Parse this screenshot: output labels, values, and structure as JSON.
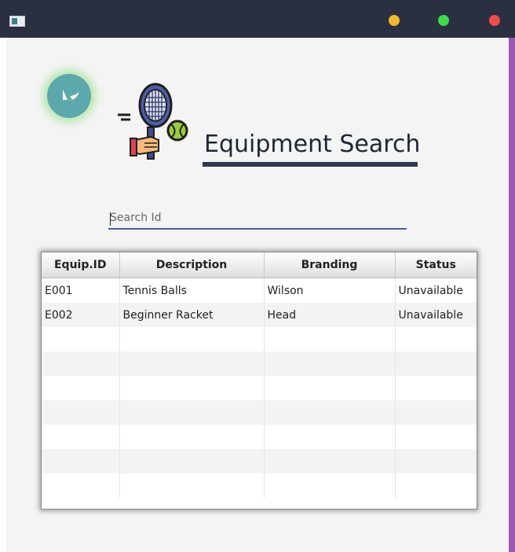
{
  "window": {
    "controls": {
      "minimize": "minimize",
      "maximize": "maximize",
      "close": "close"
    },
    "colors": {
      "minimize": "#f2b92c",
      "maximize": "#3ddc4a",
      "close": "#f14b4b",
      "accent": "#9b59b6"
    }
  },
  "header": {
    "title": "Equipment Search",
    "back_icon": "back-arrow-icon",
    "hero_icon": "tennis-racket-ball-icon"
  },
  "search": {
    "placeholder": "Search Id",
    "value": ""
  },
  "table": {
    "columns": [
      "Equip.ID",
      "Description",
      "Branding",
      "Status"
    ],
    "rows": [
      [
        "E001",
        "Tennis Balls",
        "Wilson",
        "Unavailable"
      ],
      [
        "E002",
        "Beginner Racket",
        "Head",
        "Unavailable"
      ],
      [
        "",
        "",
        "",
        ""
      ],
      [
        "",
        "",
        "",
        ""
      ],
      [
        "",
        "",
        "",
        ""
      ],
      [
        "",
        "",
        "",
        ""
      ],
      [
        "",
        "",
        "",
        ""
      ],
      [
        "",
        "",
        "",
        ""
      ],
      [
        "",
        "",
        "",
        ""
      ]
    ]
  }
}
